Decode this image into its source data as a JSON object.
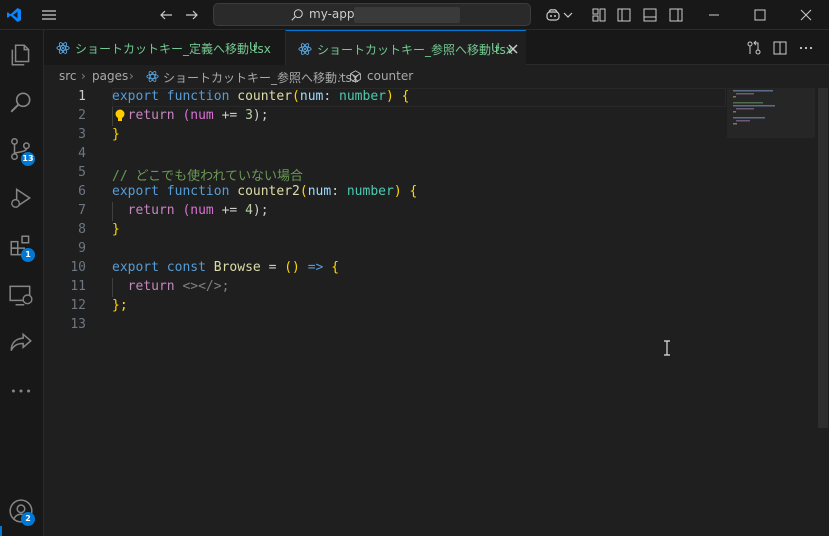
{
  "titlebar": {
    "search_text": "my-app",
    "icons": [
      "vscode-logo-icon",
      "menu-icon",
      "back-arrow-icon",
      "forward-arrow-icon",
      "search-icon",
      "copilot-icon",
      "layout-customize-icon",
      "toggle-sidebar-icon",
      "toggle-panel-icon",
      "toggle-secondary-sidebar-icon",
      "minimize-icon",
      "maximize-icon",
      "close-icon"
    ]
  },
  "activitybar": {
    "items": [
      {
        "name": "explorer-icon"
      },
      {
        "name": "search-icon"
      },
      {
        "name": "source-control-icon",
        "badge": "13"
      },
      {
        "name": "run-debug-icon"
      },
      {
        "name": "extensions-icon",
        "badge": "1"
      },
      {
        "name": "remote-explorer-icon"
      },
      {
        "name": "live-share-icon"
      },
      {
        "name": "more-icon"
      }
    ],
    "accounts_badge": "2"
  },
  "tabs": [
    {
      "name": "ショートカットキー_定義へ移動.tsx",
      "status": "U",
      "active": false
    },
    {
      "name": "ショートカットキー_参照へ移動.tsx",
      "status": "U",
      "active": true
    }
  ],
  "breadcrumb": {
    "parts": [
      "src",
      "pages",
      "ショートカットキー_参照へ移動.tsx",
      "counter"
    ]
  },
  "editor": {
    "active_line": 1,
    "lines": [
      {
        "n": "1"
      },
      {
        "n": "2"
      },
      {
        "n": "3"
      },
      {
        "n": "4"
      },
      {
        "n": "5"
      },
      {
        "n": "6"
      },
      {
        "n": "7"
      },
      {
        "n": "8"
      },
      {
        "n": "9"
      },
      {
        "n": "10"
      },
      {
        "n": "11"
      },
      {
        "n": "12"
      },
      {
        "n": "13"
      }
    ],
    "tokens": {
      "l1": [
        "export",
        "function",
        "counter",
        "(",
        "num",
        ":",
        "number",
        ")",
        "{"
      ],
      "l2": [
        "return",
        "(num",
        "+=",
        "3",
        ");"
      ],
      "l3": [
        "}"
      ],
      "l5": [
        "// どこでも使われていない場合"
      ],
      "l6": [
        "export",
        "function",
        "counter2",
        "(",
        "num",
        ":",
        "number",
        ")",
        "{"
      ],
      "l7": [
        "return",
        "(num",
        "+=",
        "4",
        ");"
      ],
      "l8": [
        "}"
      ],
      "l10": [
        "export",
        "const",
        "Browse",
        "=",
        "(",
        ")",
        "=>",
        "{"
      ],
      "l11": [
        "return",
        "<></>;"
      ],
      "l12": [
        "};"
      ]
    }
  },
  "colors": {
    "accent": "#0078d4",
    "modified_untracked": "#73c991"
  }
}
